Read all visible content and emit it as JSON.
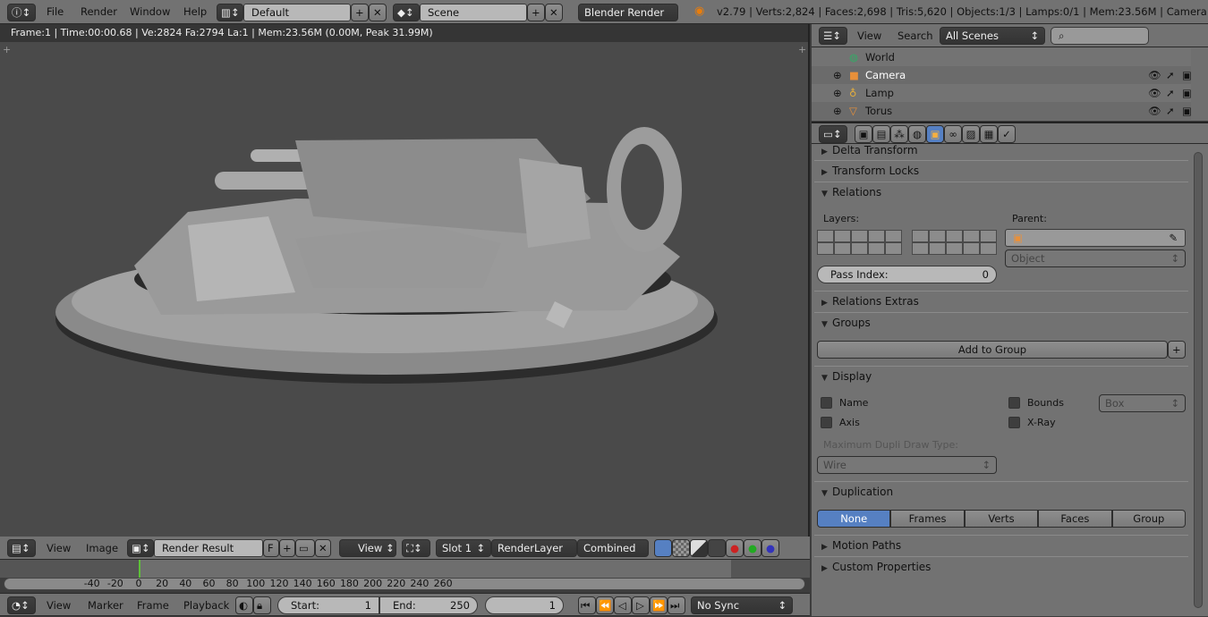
{
  "top_bar": {
    "menus": [
      "File",
      "Render",
      "Window",
      "Help"
    ],
    "layout": "Default",
    "scene": "Scene",
    "engine": "Blender Render",
    "stats": "v2.79 | Verts:2,824 | Faces:2,698 | Tris:5,620 | Objects:1/3 | Lamps:0/1 | Mem:23.56M | Camera"
  },
  "viewport": {
    "info": "Frame:1 | Time:00:00.68 | Ve:2824 Fa:2794 La:1 | Mem:23.56M (0.00M, Peak 31.99M)"
  },
  "image_editor": {
    "menus": [
      "View",
      "Image"
    ],
    "image": "Render Result",
    "fake_user": "F",
    "view": "View",
    "slot": "Slot 1",
    "layer": "RenderLayer",
    "pass": "Combined"
  },
  "timeline": {
    "ticks": [
      "-40",
      "-20",
      "0",
      "20",
      "40",
      "60",
      "80",
      "100",
      "120",
      "140",
      "160",
      "180",
      "200",
      "220",
      "240",
      "260"
    ],
    "current_frame_marker": 0,
    "menus": [
      "View",
      "Marker",
      "Frame",
      "Playback"
    ],
    "start_label": "Start:",
    "start": "1",
    "end_label": "End:",
    "end": "250",
    "current": "1",
    "sync": "No Sync"
  },
  "outliner": {
    "menus": [
      "View",
      "Search"
    ],
    "filter": "All Scenes",
    "search_placeholder": "",
    "items": [
      {
        "name": "World",
        "icon": "world-icon"
      },
      {
        "name": "Camera",
        "icon": "camera-icon"
      },
      {
        "name": "Lamp",
        "icon": "lamp-icon"
      },
      {
        "name": "Torus",
        "icon": "mesh-icon"
      }
    ]
  },
  "properties": {
    "active_tab": "object",
    "panels": {
      "delta": "Delta Transform",
      "locks": "Transform Locks",
      "relations": "Relations",
      "relations_extras": "Relations Extras",
      "groups": "Groups",
      "display": "Display",
      "duplication": "Duplication",
      "motion": "Motion Paths",
      "custom": "Custom Properties"
    },
    "relations": {
      "layers_label": "Layers:",
      "parent_label": "Parent:",
      "parent_value": "",
      "parent_type": "Object",
      "pass_index_label": "Pass Index:",
      "pass_index": "0"
    },
    "groups": {
      "add": "Add to Group"
    },
    "display": {
      "name": "Name",
      "axis": "Axis",
      "bounds": "Bounds",
      "xray": "X-Ray",
      "bounds_type": "Box",
      "max_dupli_label": "Maximum Dupli Draw Type:",
      "max_dupli": "Wire"
    },
    "duplication": {
      "options": [
        "None",
        "Frames",
        "Verts",
        "Faces",
        "Group"
      ],
      "selected": "None"
    }
  },
  "colors": {
    "accent": "#5680c2",
    "timeline_cursor": "#5fbf3a"
  }
}
